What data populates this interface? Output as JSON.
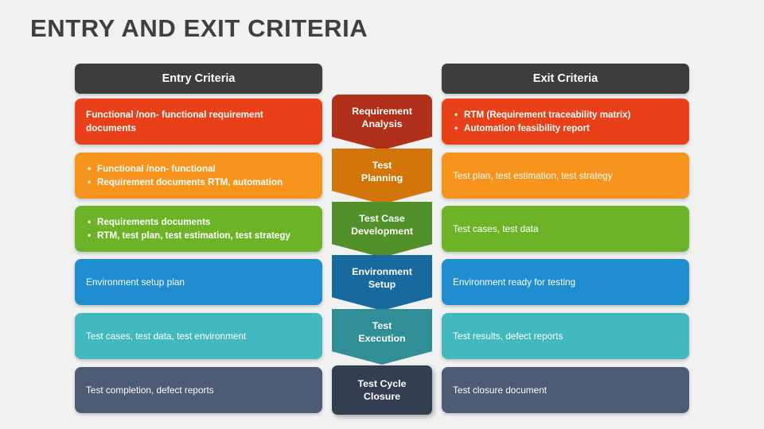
{
  "slide": {
    "title": "ENTRY AND EXIT CRITERIA",
    "background_color": "#f1f1f1",
    "title_color": "#3f3f3f"
  },
  "columns": {
    "entry_header": "Entry Criteria",
    "exit_header": "Exit Criteria",
    "header_color": "#3d3d3d"
  },
  "rows": [
    {
      "color": "#e8411a",
      "stage_color": "#b0301a",
      "stage": "Requirement\nAnalysis",
      "stage_line1": "Requirement",
      "stage_line2": "Analysis",
      "entry_bulleted": false,
      "entry_lines": [
        "Functional /non- functional requirement",
        "documents"
      ],
      "exit_bulleted": true,
      "exit_lines": [
        "RTM (Requirement traceability matrix)",
        "Automation feasibility report"
      ]
    },
    {
      "color": "#f7941e",
      "stage_color": "#d2760c",
      "stage": "Test\nPlanning",
      "stage_line1": "Test",
      "stage_line2": "Planning",
      "entry_bulleted": true,
      "entry_lines": [
        "Functional /non- functional",
        "Requirement documents RTM, automation"
      ],
      "exit_bulleted": false,
      "exit_lines": [
        "Test plan, test estimation, test strategy"
      ]
    },
    {
      "color": "#6cb327",
      "stage_color": "#52912a",
      "stage": "Test Case\nDevelopment",
      "stage_line1": "Test Case",
      "stage_line2": "Development",
      "entry_bulleted": true,
      "entry_lines": [
        "Requirements documents",
        "RTM, test plan, test estimation, test strategy"
      ],
      "exit_bulleted": false,
      "exit_lines": [
        "Test cases, test data"
      ]
    },
    {
      "color": "#1f8dd0",
      "stage_color": "#17699e",
      "stage": "Environment\nSetup",
      "stage_line1": "Environment",
      "stage_line2": "Setup",
      "entry_bulleted": false,
      "entry_lines": [
        "Environment setup plan"
      ],
      "exit_bulleted": false,
      "exit_lines": [
        "Environment ready for testing"
      ]
    },
    {
      "color": "#41b9bf",
      "stage_color": "#2f8e96",
      "stage": "Test\nExecution",
      "stage_line1": "Test",
      "stage_line2": "Execution",
      "entry_bulleted": false,
      "entry_lines": [
        "Test cases, test data, test environment"
      ],
      "exit_bulleted": false,
      "exit_lines": [
        "Test results, defect reports"
      ]
    },
    {
      "color": "#4c5a72",
      "stage_color": "#333e51",
      "stage": "Test Cycle\nClosure",
      "stage_line1": "Test Cycle",
      "stage_line2": "Closure",
      "entry_bulleted": false,
      "entry_lines": [
        "Test completion, defect reports"
      ],
      "exit_bulleted": false,
      "exit_lines": [
        "Test closure document"
      ]
    }
  ]
}
